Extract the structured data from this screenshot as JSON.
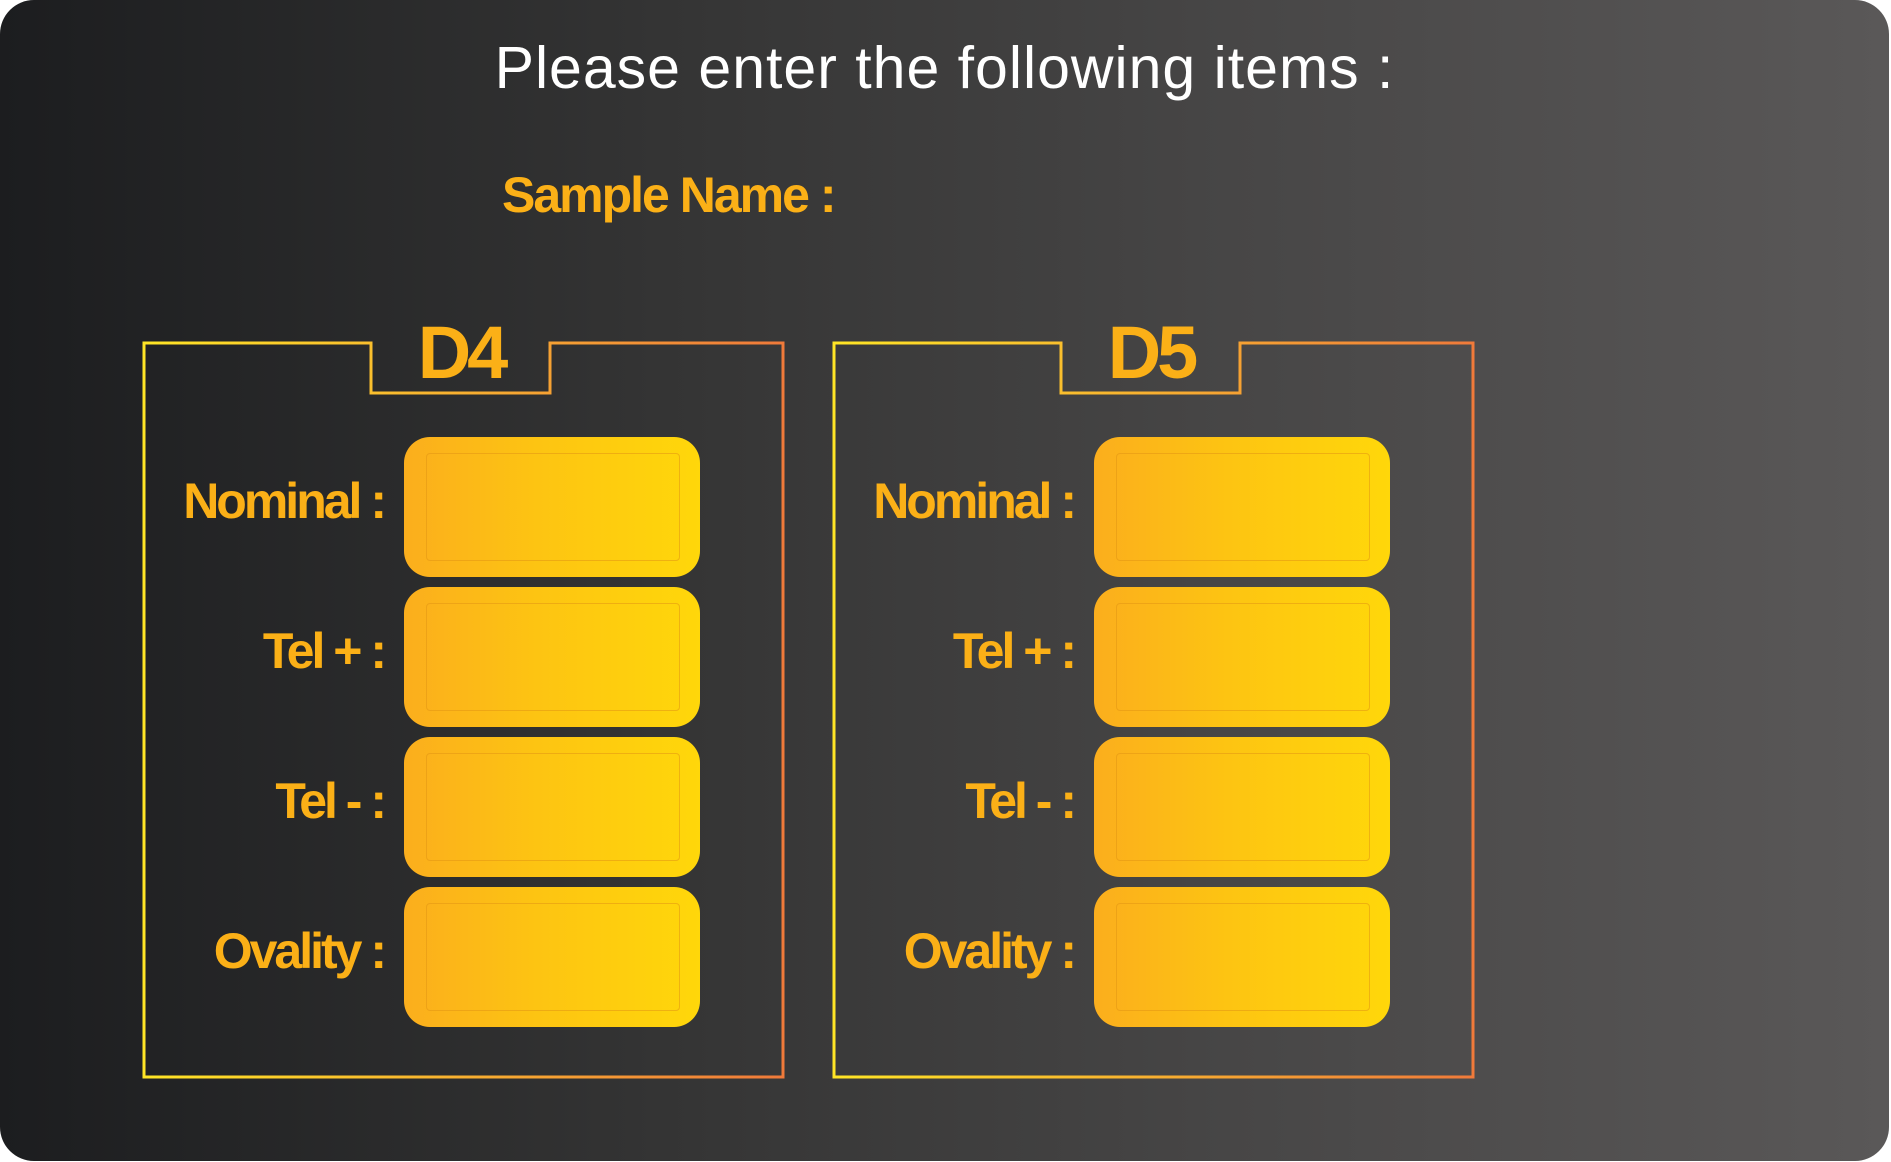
{
  "header": {
    "title": "Please enter the following items :"
  },
  "sample": {
    "label": "Sample Name :"
  },
  "groups": [
    {
      "title": "D4",
      "rows": [
        {
          "label": "Nominal :"
        },
        {
          "label": "Tel + :"
        },
        {
          "label": "Tel - :"
        },
        {
          "label": "Ovality :"
        }
      ]
    },
    {
      "title": "D5",
      "rows": [
        {
          "label": "Nominal :"
        },
        {
          "label": "Tel + :"
        },
        {
          "label": "Tel - :"
        },
        {
          "label": "Ovality :"
        }
      ]
    }
  ],
  "colors": {
    "accent_text": "#fbb017",
    "field_gradient_start": "#fbae1d",
    "field_gradient_end": "#ffd70a",
    "frame_gradient_start": "#ffe526",
    "frame_gradient_end": "#f07a3a",
    "title_text": "#ffffff"
  }
}
